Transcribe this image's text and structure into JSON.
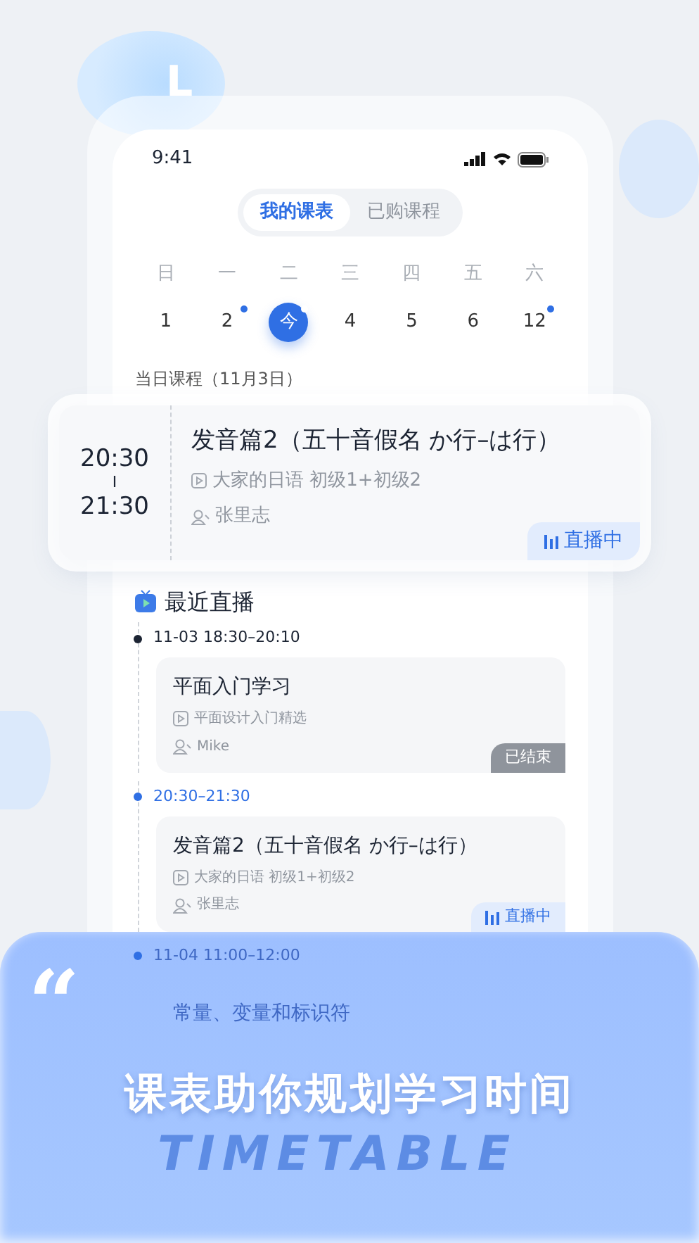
{
  "badge_letter": "L",
  "status_bar": {
    "time": "9:41"
  },
  "tabs": [
    {
      "label": "我的课表",
      "selected": true
    },
    {
      "label": "已购课程",
      "selected": false
    }
  ],
  "weekdays": [
    "日",
    "一",
    "二",
    "三",
    "四",
    "五",
    "六"
  ],
  "days": [
    {
      "label": "1",
      "selected": false,
      "has_event": false
    },
    {
      "label": "2",
      "selected": false,
      "has_event": true
    },
    {
      "label": "今",
      "selected": true,
      "has_event": true
    },
    {
      "label": "4",
      "selected": false,
      "has_event": false
    },
    {
      "label": "5",
      "selected": false,
      "has_event": false
    },
    {
      "label": "6",
      "selected": false,
      "has_event": false
    },
    {
      "label": "12",
      "selected": false,
      "has_event": true
    }
  ],
  "day_heading": "当日课程（11月3日）",
  "today_card": {
    "start": "20:30",
    "separator": "I",
    "end": "21:30",
    "title": "发音篇2（五十音假名 か行–は行）",
    "course": "大家的日语 初级1+初级2",
    "teacher": "张里志",
    "status": {
      "kind": "live",
      "label": "直播中"
    }
  },
  "recent": {
    "heading": "最近直播",
    "items": [
      {
        "time": "11-03 18:30–20:10",
        "current": false,
        "dimmed": false,
        "title": "平面入门学习",
        "course": "平面设计入门精选",
        "teacher": "Mike",
        "status": {
          "kind": "ended",
          "label": "已结束"
        }
      },
      {
        "time": "20:30–21:30",
        "current": true,
        "dimmed": false,
        "title": "发音篇2（五十音假名 か行–は行）",
        "course": "大家的日语 初级1+初级2",
        "teacher": "张里志",
        "status": {
          "kind": "live",
          "label": "直播中"
        }
      },
      {
        "time": "11-04 11:00–12:00",
        "current": true,
        "dimmed": true,
        "title": "常量、变量和标识符"
      }
    ]
  },
  "banner": {
    "quote_mark": "“",
    "headline": "课表助你规划学习时间",
    "backdrop_word": "TIMETABLE"
  }
}
